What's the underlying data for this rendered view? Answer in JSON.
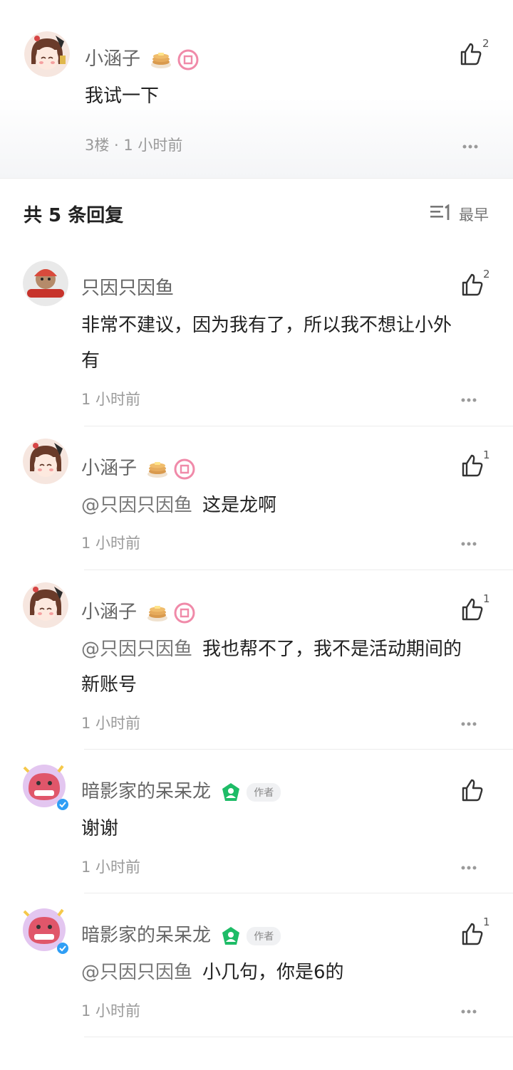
{
  "main_comment": {
    "author": "小涵子",
    "text": "我试一下",
    "floor_time": "3楼 · 1 小时前",
    "likes": "2"
  },
  "replies_header": {
    "title": "共 5 条回复",
    "sort_label": "最早"
  },
  "replies": [
    {
      "author": "只因只因鱼",
      "line1": "非常不建议，因为我有了，所以我不想让小外",
      "line2": "有",
      "time": "1 小时前",
      "likes": "2"
    },
    {
      "author": "小涵子",
      "mention": "@只因只因鱼",
      "line1": "这是龙啊",
      "time": "1 小时前",
      "likes": "1"
    },
    {
      "author": "小涵子",
      "mention": "@只因只因鱼",
      "line1": "我也帮不了，我不是活动期间的",
      "line2": "新账号",
      "time": "1 小时前",
      "likes": "1"
    },
    {
      "author": "暗影家的呆呆龙",
      "author_tag": "作者",
      "line1": "谢谢",
      "time": "1 小时前",
      "likes": ""
    },
    {
      "author": "暗影家的呆呆龙",
      "author_tag": "作者",
      "mention": "@只因只因鱼",
      "line1": "小几句，你是6的",
      "time": "1 小时前",
      "likes": "1"
    }
  ],
  "colors": {
    "author_badge_green": "#1ebc67",
    "level_badge_pink": "#f08aa9"
  }
}
